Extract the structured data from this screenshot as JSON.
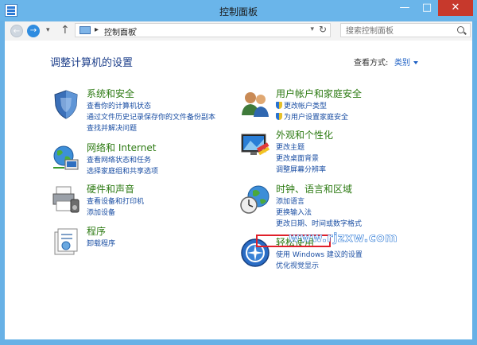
{
  "window": {
    "title": "控制面板",
    "min_label": "—",
    "max_label": "□",
    "close_label": "✕"
  },
  "nav": {
    "back_glyph": "←",
    "forward_glyph": "→",
    "dropdown_glyph": "▾",
    "up_glyph": "↑",
    "address_sep": "▸",
    "address_text": "控制面板",
    "address_chevron": "›",
    "address_dropdown": "▾",
    "refresh_glyph": "↻",
    "search_placeholder": "搜索控制面板"
  },
  "content": {
    "heading": "调整计算机的设置",
    "view_by_label": "查看方式:",
    "view_by_value": "类别"
  },
  "categories": [
    {
      "title": "系统和安全",
      "links": [
        "查看你的计算机状态",
        "通过文件历史记录保存你的文件备份副本",
        "查找并解决问题"
      ]
    },
    {
      "title": "网络和 Internet",
      "links": [
        "查看网络状态和任务",
        "选择家庭组和共享选项"
      ]
    },
    {
      "title": "硬件和声音",
      "links": [
        "查看设备和打印机",
        "添加设备"
      ]
    },
    {
      "title": "程序",
      "links": [
        "卸载程序"
      ]
    },
    {
      "title": "用户帐户和家庭安全",
      "links": [
        "更改帐户类型",
        "为用户设置家庭安全"
      ]
    },
    {
      "title": "外观和个性化",
      "links": [
        "更改主题",
        "更改桌面背景",
        "调整屏幕分辨率"
      ]
    },
    {
      "title": "时钟、语言和区域",
      "links": [
        "添加语言",
        "更换输入法",
        "更改日期、时间或数字格式"
      ]
    },
    {
      "title": "轻松使用",
      "links": [
        "使用 Windows 建议的设置",
        "优化视觉显示"
      ]
    }
  ],
  "watermark": "www.rjzxw.com",
  "colors": {
    "title_green": "#2c7a12",
    "link_blue": "#1a4ea3",
    "highlight_red": "#e0202a",
    "frame_blue": "#68b1e6"
  }
}
